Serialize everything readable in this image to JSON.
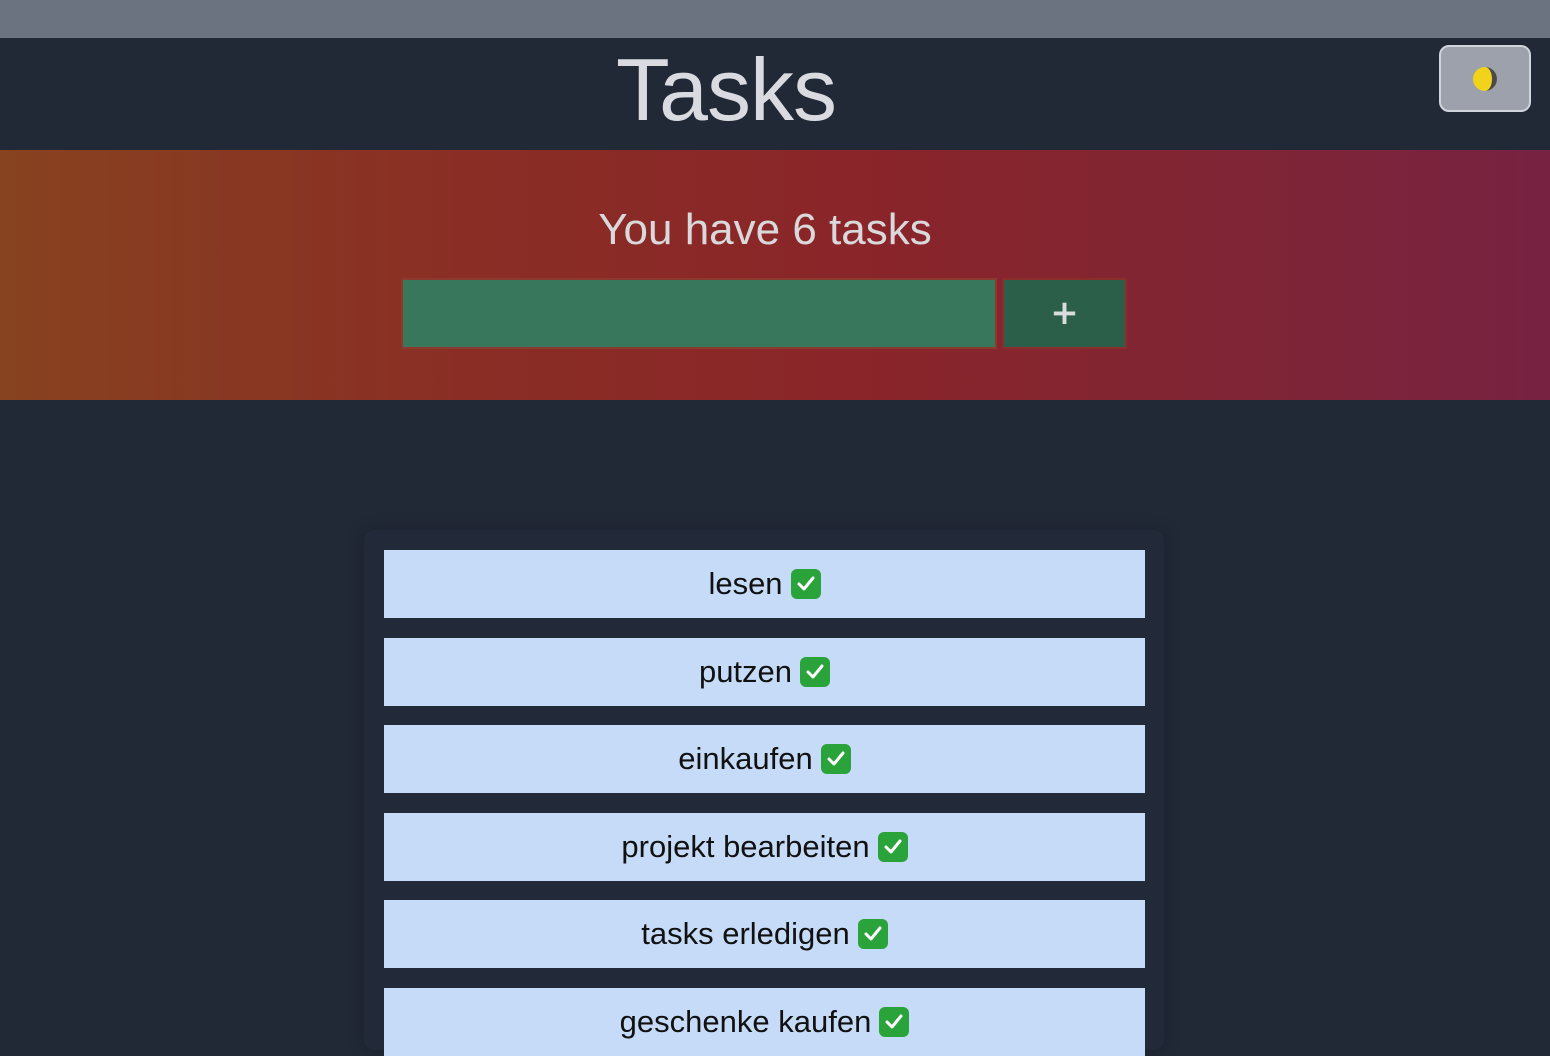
{
  "header": {
    "title": "Tasks",
    "theme_toggle_icon": "moon-icon"
  },
  "hero": {
    "count_text": "You have 6 tasks",
    "input_value": "",
    "add_button_label": "+"
  },
  "tasks": [
    {
      "label": "lesen",
      "status_icon": "check-icon"
    },
    {
      "label": "putzen",
      "status_icon": "check-icon"
    },
    {
      "label": "einkaufen",
      "status_icon": "check-icon"
    },
    {
      "label": "projekt bearbeiten",
      "status_icon": "check-icon"
    },
    {
      "label": "tasks erledigen",
      "status_icon": "check-icon"
    },
    {
      "label": "geschenke kaufen",
      "status_icon": "check-icon"
    }
  ],
  "colors": {
    "background": "#212836",
    "topbar": "#6b7280",
    "input": "#38775c",
    "add_button": "#2c5f4a",
    "task_item": "#c5dbf8",
    "check": "#2aa33a"
  }
}
